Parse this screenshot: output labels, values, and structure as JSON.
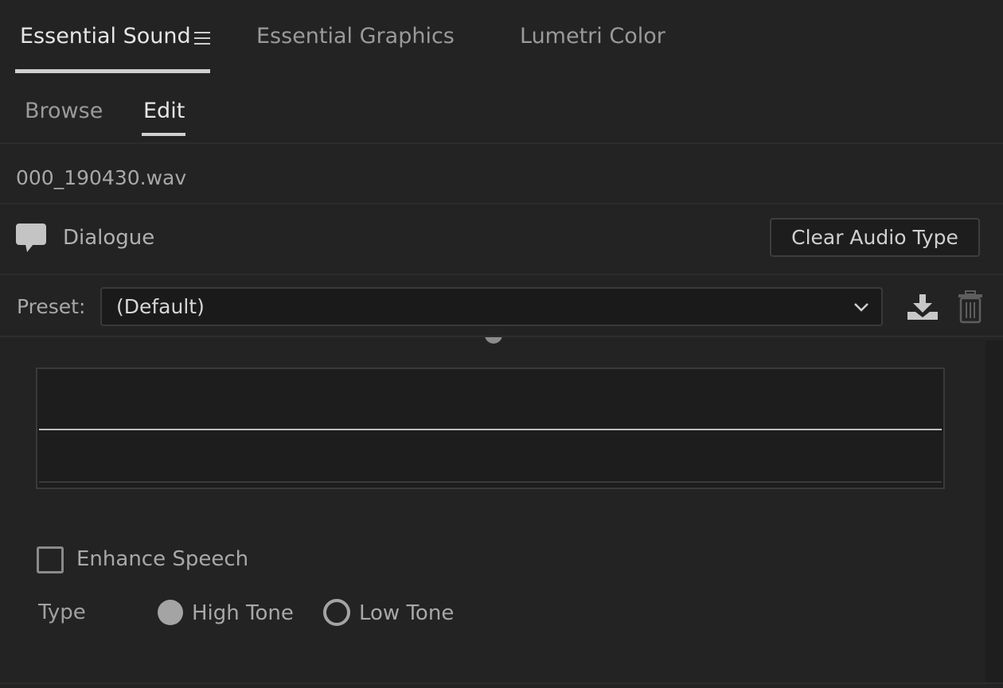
{
  "panel_tabs": {
    "essential_sound": "Essential Sound",
    "essential_graphics": "Essential Graphics",
    "lumetri_color": "Lumetri Color"
  },
  "sub_tabs": {
    "browse": "Browse",
    "edit": "Edit"
  },
  "clip": {
    "name": "000_190430.wav"
  },
  "audio_type": {
    "icon": "speech-bubble-icon",
    "label": "Dialogue",
    "clear_button": "Clear Audio Type"
  },
  "preset": {
    "label": "Preset:",
    "value": "(Default)"
  },
  "enhance_speech": {
    "label": "Enhance Speech",
    "checked": false
  },
  "type": {
    "label": "Type",
    "options": [
      {
        "label": "High Tone",
        "selected": true
      },
      {
        "label": "Low Tone",
        "selected": false
      }
    ]
  },
  "colors": {
    "background": "#232323",
    "text": "#a8a8a8",
    "active_text": "#e6e6e6"
  }
}
